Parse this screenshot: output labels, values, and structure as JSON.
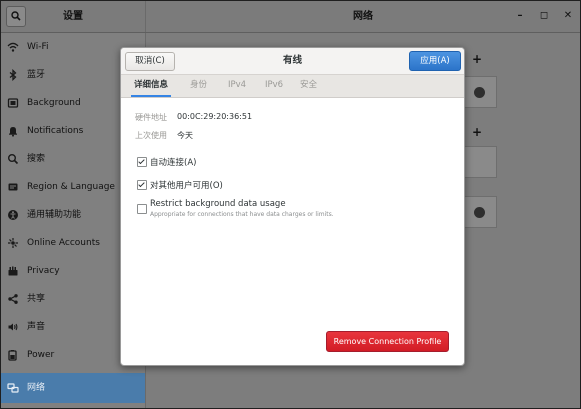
{
  "window": {
    "sidebar_title": "设置",
    "title": "网络",
    "controls": {
      "minimize": "–",
      "maximize": "◻",
      "close": "✕"
    }
  },
  "sidebar": {
    "items": [
      {
        "label": "Wi-Fi",
        "icon": "wifi-icon"
      },
      {
        "label": "蓝牙",
        "icon": "bluetooth-icon"
      },
      {
        "label": "Background",
        "icon": "background-icon"
      },
      {
        "label": "Notifications",
        "icon": "notifications-icon"
      },
      {
        "label": "搜索",
        "icon": "search-icon"
      },
      {
        "label": "Region & Language",
        "icon": "region-icon"
      },
      {
        "label": "通用辅助功能",
        "icon": "accessibility-icon"
      },
      {
        "label": "Online Accounts",
        "icon": "online-accounts-icon"
      },
      {
        "label": "Privacy",
        "icon": "privacy-icon"
      },
      {
        "label": "共享",
        "icon": "share-icon"
      },
      {
        "label": "声音",
        "icon": "sound-icon"
      },
      {
        "label": "Power",
        "icon": "power-icon"
      },
      {
        "label": "网络",
        "icon": "network-icon",
        "selected": true
      }
    ]
  },
  "main": {
    "add_label": "+"
  },
  "dialog": {
    "title": "有线",
    "cancel_label": "取消(C)",
    "apply_label": "应用(A)",
    "tabs": [
      "详细信息",
      "身份",
      "IPv4",
      "IPv6",
      "安全"
    ],
    "active_tab": "详细信息",
    "details": {
      "hardware_address_label": "硬件地址",
      "hardware_address": "00:0C:29:20:36:51",
      "last_used_label": "上次使用",
      "last_used": "今天"
    },
    "options": {
      "auto_connect": {
        "label": "自动连接(A)",
        "checked": true
      },
      "all_users": {
        "label": "对其他用户可用(O)",
        "checked": true
      },
      "restrict_background": {
        "label": "Restrict background data usage",
        "description": "Appropriate for connections that have data charges or limits.",
        "checked": false
      }
    },
    "remove_label": "Remove Connection Profile"
  },
  "colors": {
    "accent": "#3584e4",
    "selected_sidebar": "#4a7cab",
    "destructive": "#d21c25"
  }
}
